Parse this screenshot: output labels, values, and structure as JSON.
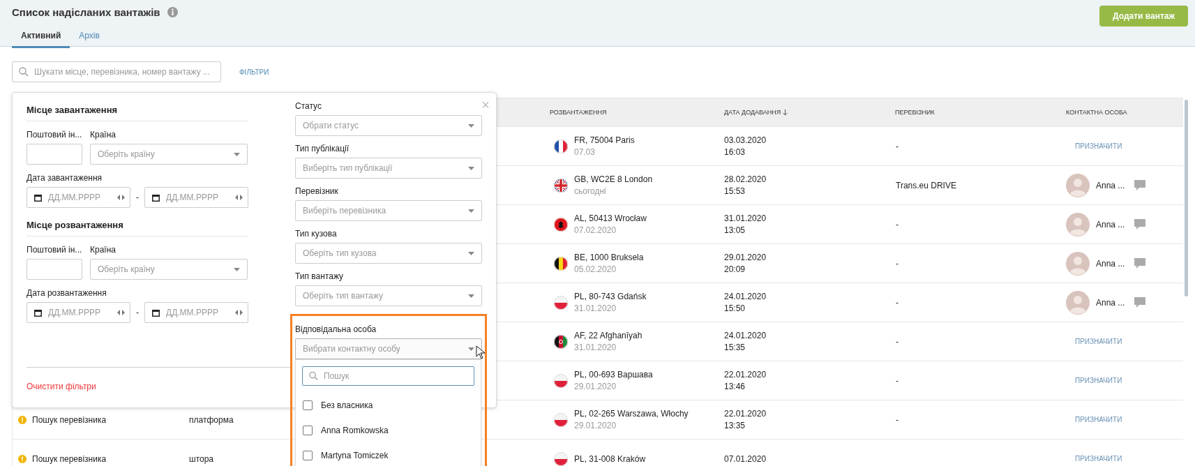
{
  "header": {
    "title": "Список надісланих вантажів",
    "add_button": "Додати вантаж"
  },
  "tabs": [
    {
      "label": "Активний",
      "selected": true
    },
    {
      "label": "Архів",
      "selected": false
    }
  ],
  "search": {
    "placeholder": "Шукати місце, перевізника, номер вантажу ..."
  },
  "filters_link": "ФІЛЬТРИ",
  "table": {
    "columns": [
      {
        "label": "РОЗВАНТАЖЕННЯ",
        "sorted": false
      },
      {
        "label": "ДАТА ДОДАВАННЯ",
        "sorted": true
      },
      {
        "label": "ПЕРЕВІЗНИК",
        "sorted": false
      },
      {
        "label": "КОНТАКТНА ОСОБА",
        "sorted": false
      }
    ],
    "rows": [
      {
        "flag": {
          "kind": "fr"
        },
        "place": "FR, 75004 Paris",
        "unload_date": "07.03",
        "added_date": "03.03.2020",
        "added_time": "16:03",
        "carrier": "-",
        "contact": {
          "kind": "assign",
          "label": "ПРИЗНАЧИТИ"
        }
      },
      {
        "flag": {
          "kind": "gb"
        },
        "place": "GB, WC2E 8 London",
        "unload_date": "сьогодні",
        "added_date": "28.02.2020",
        "added_time": "15:53",
        "carrier": "Trans.eu DRIVE",
        "contact": {
          "kind": "person",
          "label": "Anna ..."
        }
      },
      {
        "flag": {
          "kind": "al"
        },
        "place": "AL, 50413 Wrocław",
        "unload_date": "07.02.2020",
        "added_date": "31.01.2020",
        "added_time": "13:05",
        "carrier": "-",
        "contact": {
          "kind": "person",
          "label": "Anna ..."
        }
      },
      {
        "flag": {
          "kind": "be"
        },
        "place": "BE, 1000 Bruksela",
        "unload_date": "05.02.2020",
        "added_date": "29.01.2020",
        "added_time": "20:09",
        "carrier": "-",
        "contact": {
          "kind": "person",
          "label": "Anna ..."
        }
      },
      {
        "flag": {
          "kind": "pl"
        },
        "place": "PL, 80-743 Gdańsk",
        "unload_date": "31.01.2020",
        "added_date": "24.01.2020",
        "added_time": "15:50",
        "carrier": "-",
        "contact": {
          "kind": "person",
          "label": "Anna ..."
        }
      },
      {
        "flag": {
          "kind": "af"
        },
        "place": "AF, 22 Afghanīyah",
        "unload_date": "31.01.2020",
        "added_date": "24.01.2020",
        "added_time": "15:35",
        "carrier": "-",
        "contact": {
          "kind": "assign",
          "label": "ПРИЗНАЧИТИ"
        }
      },
      {
        "flag": {
          "kind": "pl"
        },
        "place": "PL, 00-693 Варшава",
        "unload_date": "29.01.2020",
        "added_date": "22.01.2020",
        "added_time": "13:46",
        "carrier": "-",
        "contact": {
          "kind": "assign",
          "label": "ПРИЗНАЧИТИ"
        }
      },
      {
        "status": {
          "kind": "warning",
          "label": "Пошук перевізника"
        },
        "body_type": "платформа",
        "flag": {
          "kind": "pl"
        },
        "place": "PL, 02-265 Warszawa, Włochy",
        "unload_date": "29.01.2020",
        "added_date": "22.01.2020",
        "added_time": "13:35",
        "carrier": "-",
        "contact": {
          "kind": "assign",
          "label": "ПРИЗНАЧИТИ"
        }
      },
      {
        "status": {
          "kind": "warning",
          "label": "Пошук перевізника"
        },
        "body_type": "штора",
        "flag": {
          "kind": "pl"
        },
        "place": "PL, 31-008 Kraków",
        "added_date": "07.01.2020",
        "contact": {
          "kind": "assign",
          "label": "ПРИЗНАЧИТИ"
        }
      }
    ]
  },
  "filter_panel": {
    "close": "×",
    "places": [
      {
        "title": "Місце завантаження",
        "postal_label": "Поштовий ін...",
        "country_label": "Країна",
        "country_placeholder": "Оберіть країну",
        "date_label": "Дата завантаження",
        "date_from_placeholder": "ДД.ММ.РРРР",
        "separator": "-",
        "date_to_placeholder": "ДД.ММ.РРРР"
      },
      {
        "title": "Місце розвантаження",
        "postal_label": "Поштовий ін...",
        "country_label": "Країна",
        "country_placeholder": "Оберіть країну",
        "date_label": "Дата розвантаження",
        "date_from_placeholder": "ДД.ММ.РРРР",
        "separator": "-",
        "date_to_placeholder": "ДД.ММ.РРРР"
      }
    ],
    "clear_link": "Очистити фільтри",
    "selects": [
      {
        "label": "Статус",
        "placeholder": "Обрати статус",
        "open": false,
        "highlighted": false
      },
      {
        "label": "Тип публікації",
        "placeholder": "Виберіть тип публікації",
        "open": false,
        "highlighted": false
      },
      {
        "label": "Перевізник",
        "placeholder": "Виберіть перевізника",
        "open": false,
        "highlighted": false
      },
      {
        "label": "Тип кузова",
        "placeholder": "Оберіть тип кузова",
        "open": false,
        "highlighted": false
      },
      {
        "label": "Тип вантажу",
        "placeholder": "Оберіть тип вантажу",
        "open": false,
        "highlighted": false
      },
      {
        "label": "Відповідальна особа",
        "placeholder": "Вибрати контактну особу",
        "open": true,
        "highlighted": true,
        "dropdown": {
          "search_placeholder": "Пошук",
          "options": [
            {
              "label": "Без власника",
              "checked": false
            },
            {
              "label": "Anna Romkowska",
              "checked": false
            },
            {
              "label": "Martyna Tomiczek",
              "checked": false
            }
          ]
        }
      }
    ]
  }
}
